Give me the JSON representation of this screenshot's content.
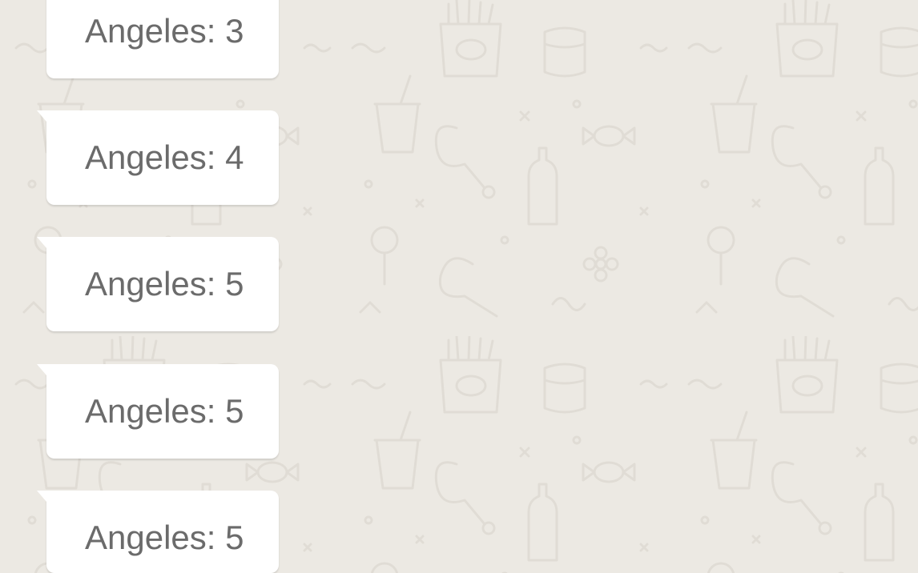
{
  "chat": {
    "background_color": "#ece9e3",
    "bubble_color": "#ffffff",
    "text_color": "#6b6b6b",
    "messages": [
      {
        "text": "Angeles: 3"
      },
      {
        "text": "Angeles: 4"
      },
      {
        "text": "Angeles: 5"
      },
      {
        "text": "Angeles: 5"
      },
      {
        "text": "Angeles: 5"
      }
    ]
  }
}
